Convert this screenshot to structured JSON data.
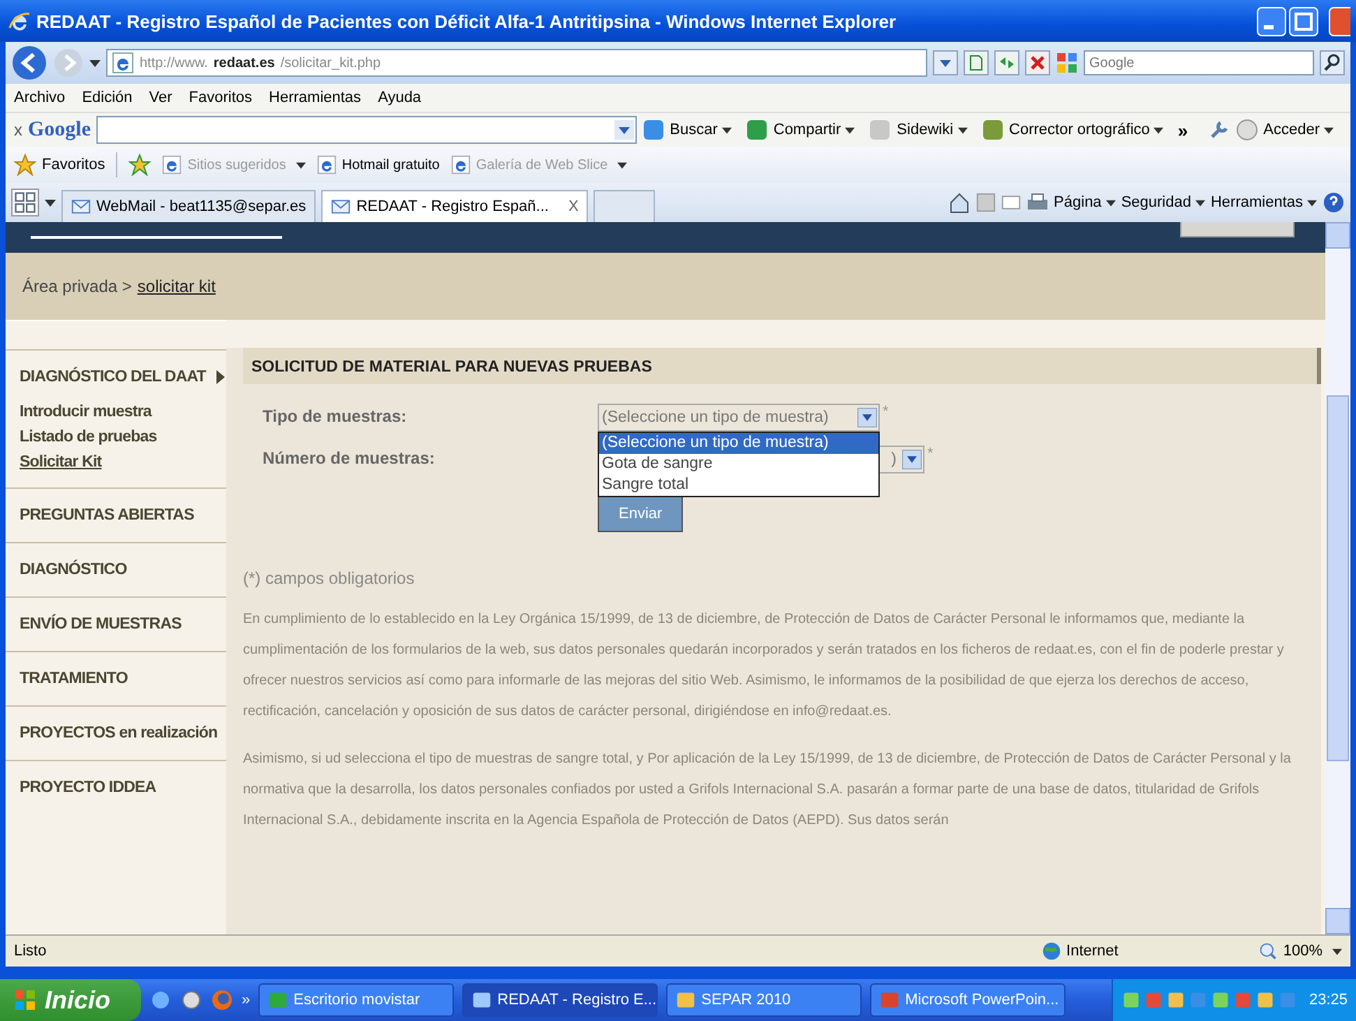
{
  "window": {
    "title": "REDAAT - Registro Español de Pacientes con Déficit Alfa-1 Antritipsina - Windows Internet Explorer"
  },
  "address_bar": {
    "url_prefix": "http://www.",
    "url_domain": "redaat.es",
    "url_path": "/solicitar_kit.php",
    "search_placeholder": "Google"
  },
  "menu": [
    "Archivo",
    "Edición",
    "Ver",
    "Favoritos",
    "Herramientas",
    "Ayuda"
  ],
  "google_toolbar": {
    "close": "x",
    "logo": "Google",
    "items": [
      "Buscar",
      "Compartir",
      "Sidewiki",
      "Corrector ortográfico"
    ],
    "more": "»",
    "sign_in": "Acceder"
  },
  "favorites_bar": {
    "label": "Favoritos",
    "items": [
      {
        "label": "Sitios sugeridos",
        "disabled": true
      },
      {
        "label": "Hotmail gratuito",
        "disabled": false
      },
      {
        "label": "Galería de Web Slice",
        "disabled": true
      }
    ]
  },
  "tabs": [
    {
      "label": "WebMail - beat1135@separ.es",
      "selected": false
    },
    {
      "label": "REDAAT - Registro Españ...",
      "selected": true,
      "close": "X"
    }
  ],
  "command_bar": [
    "Página",
    "Seguridad",
    "Herramientas"
  ],
  "breadcrumb": {
    "root": "Área privada >",
    "current": "solicitar kit"
  },
  "sidebar": {
    "items": [
      {
        "label": "DIAGNÓSTICO DEL DAAT",
        "expanded": true,
        "children": [
          {
            "label": "Introducir muestra",
            "selected": false
          },
          {
            "label": "Listado de pruebas",
            "selected": false
          },
          {
            "label": "Solicitar Kit",
            "selected": true
          }
        ]
      },
      {
        "label": "PREGUNTAS ABIERTAS",
        "expanded": false
      },
      {
        "label": "DIAGNÓSTICO",
        "expanded": false
      },
      {
        "label": "ENVÍO DE MUESTRAS",
        "expanded": false
      },
      {
        "label": "TRATAMIENTO",
        "expanded": false
      },
      {
        "label": "PROYECTOS en realización",
        "expanded": false
      },
      {
        "label": "PROYECTO IDDEA",
        "expanded": false
      }
    ]
  },
  "form": {
    "title": "SOLICITUD DE MATERIAL PARA NUEVAS PRUEBAS",
    "fields": [
      {
        "label": "Tipo de muestras:",
        "value": "(Seleccione un tipo de muestra)",
        "required_mark": "*",
        "expanded": true,
        "options": [
          {
            "label": "(Seleccione un tipo de muestra)",
            "selected": true
          },
          {
            "label": "Gota de sangre",
            "selected": false
          },
          {
            "label": "Sangre total",
            "selected": false
          }
        ]
      },
      {
        "label": "Número de muestras:",
        "value": ")",
        "required_mark": "*",
        "expanded": false
      }
    ],
    "submit": "Enviar",
    "note": "(*) campos obligatorios",
    "paragraphs": [
      "En cumplimiento de lo establecido en la Ley Orgánica 15/1999, de 13 de diciembre, de Protección de Datos de Carácter Personal le informamos que, mediante la cumplimentación de los formularios de la web, sus datos personales quedarán incorporados y serán tratados en los ficheros de redaat.es, con el fin de poderle prestar y ofrecer nuestros servicios así como para informarle de las mejoras del sitio Web. Asimismo, le informamos de la posibilidad de que ejerza los derechos de acceso, rectificación, cancelación y oposición de sus datos de carácter personal, dirigiéndose en info@redaat.es.",
      "Asimismo, si ud selecciona el tipo de muestras de sangre total, y Por aplicación de la Ley 15/1999, de 13 de diciembre, de Protección de Datos de Carácter Personal y la normativa que la desarrolla, los datos personales confiados por usted a Grifols Internacional S.A. pasarán a formar parte de una base de datos, titularidad de Grifols Internacional S.A., debidamente inscrita en la Agencia Española de Protección de Datos (AEPD). Sus datos serán"
    ]
  },
  "status_bar": {
    "text": "Listo",
    "zone": "Internet",
    "zoom": "100%"
  },
  "taskbar": {
    "start": "Inicio",
    "more": "»",
    "tasks": [
      {
        "label": "Escritorio movistar",
        "selected": false
      },
      {
        "label": "REDAAT - Registro E...",
        "selected": true
      },
      {
        "label": "SEPAR 2010",
        "selected": false
      },
      {
        "label": "Microsoft PowerPoin...",
        "selected": false
      }
    ],
    "clock": "23:25"
  }
}
